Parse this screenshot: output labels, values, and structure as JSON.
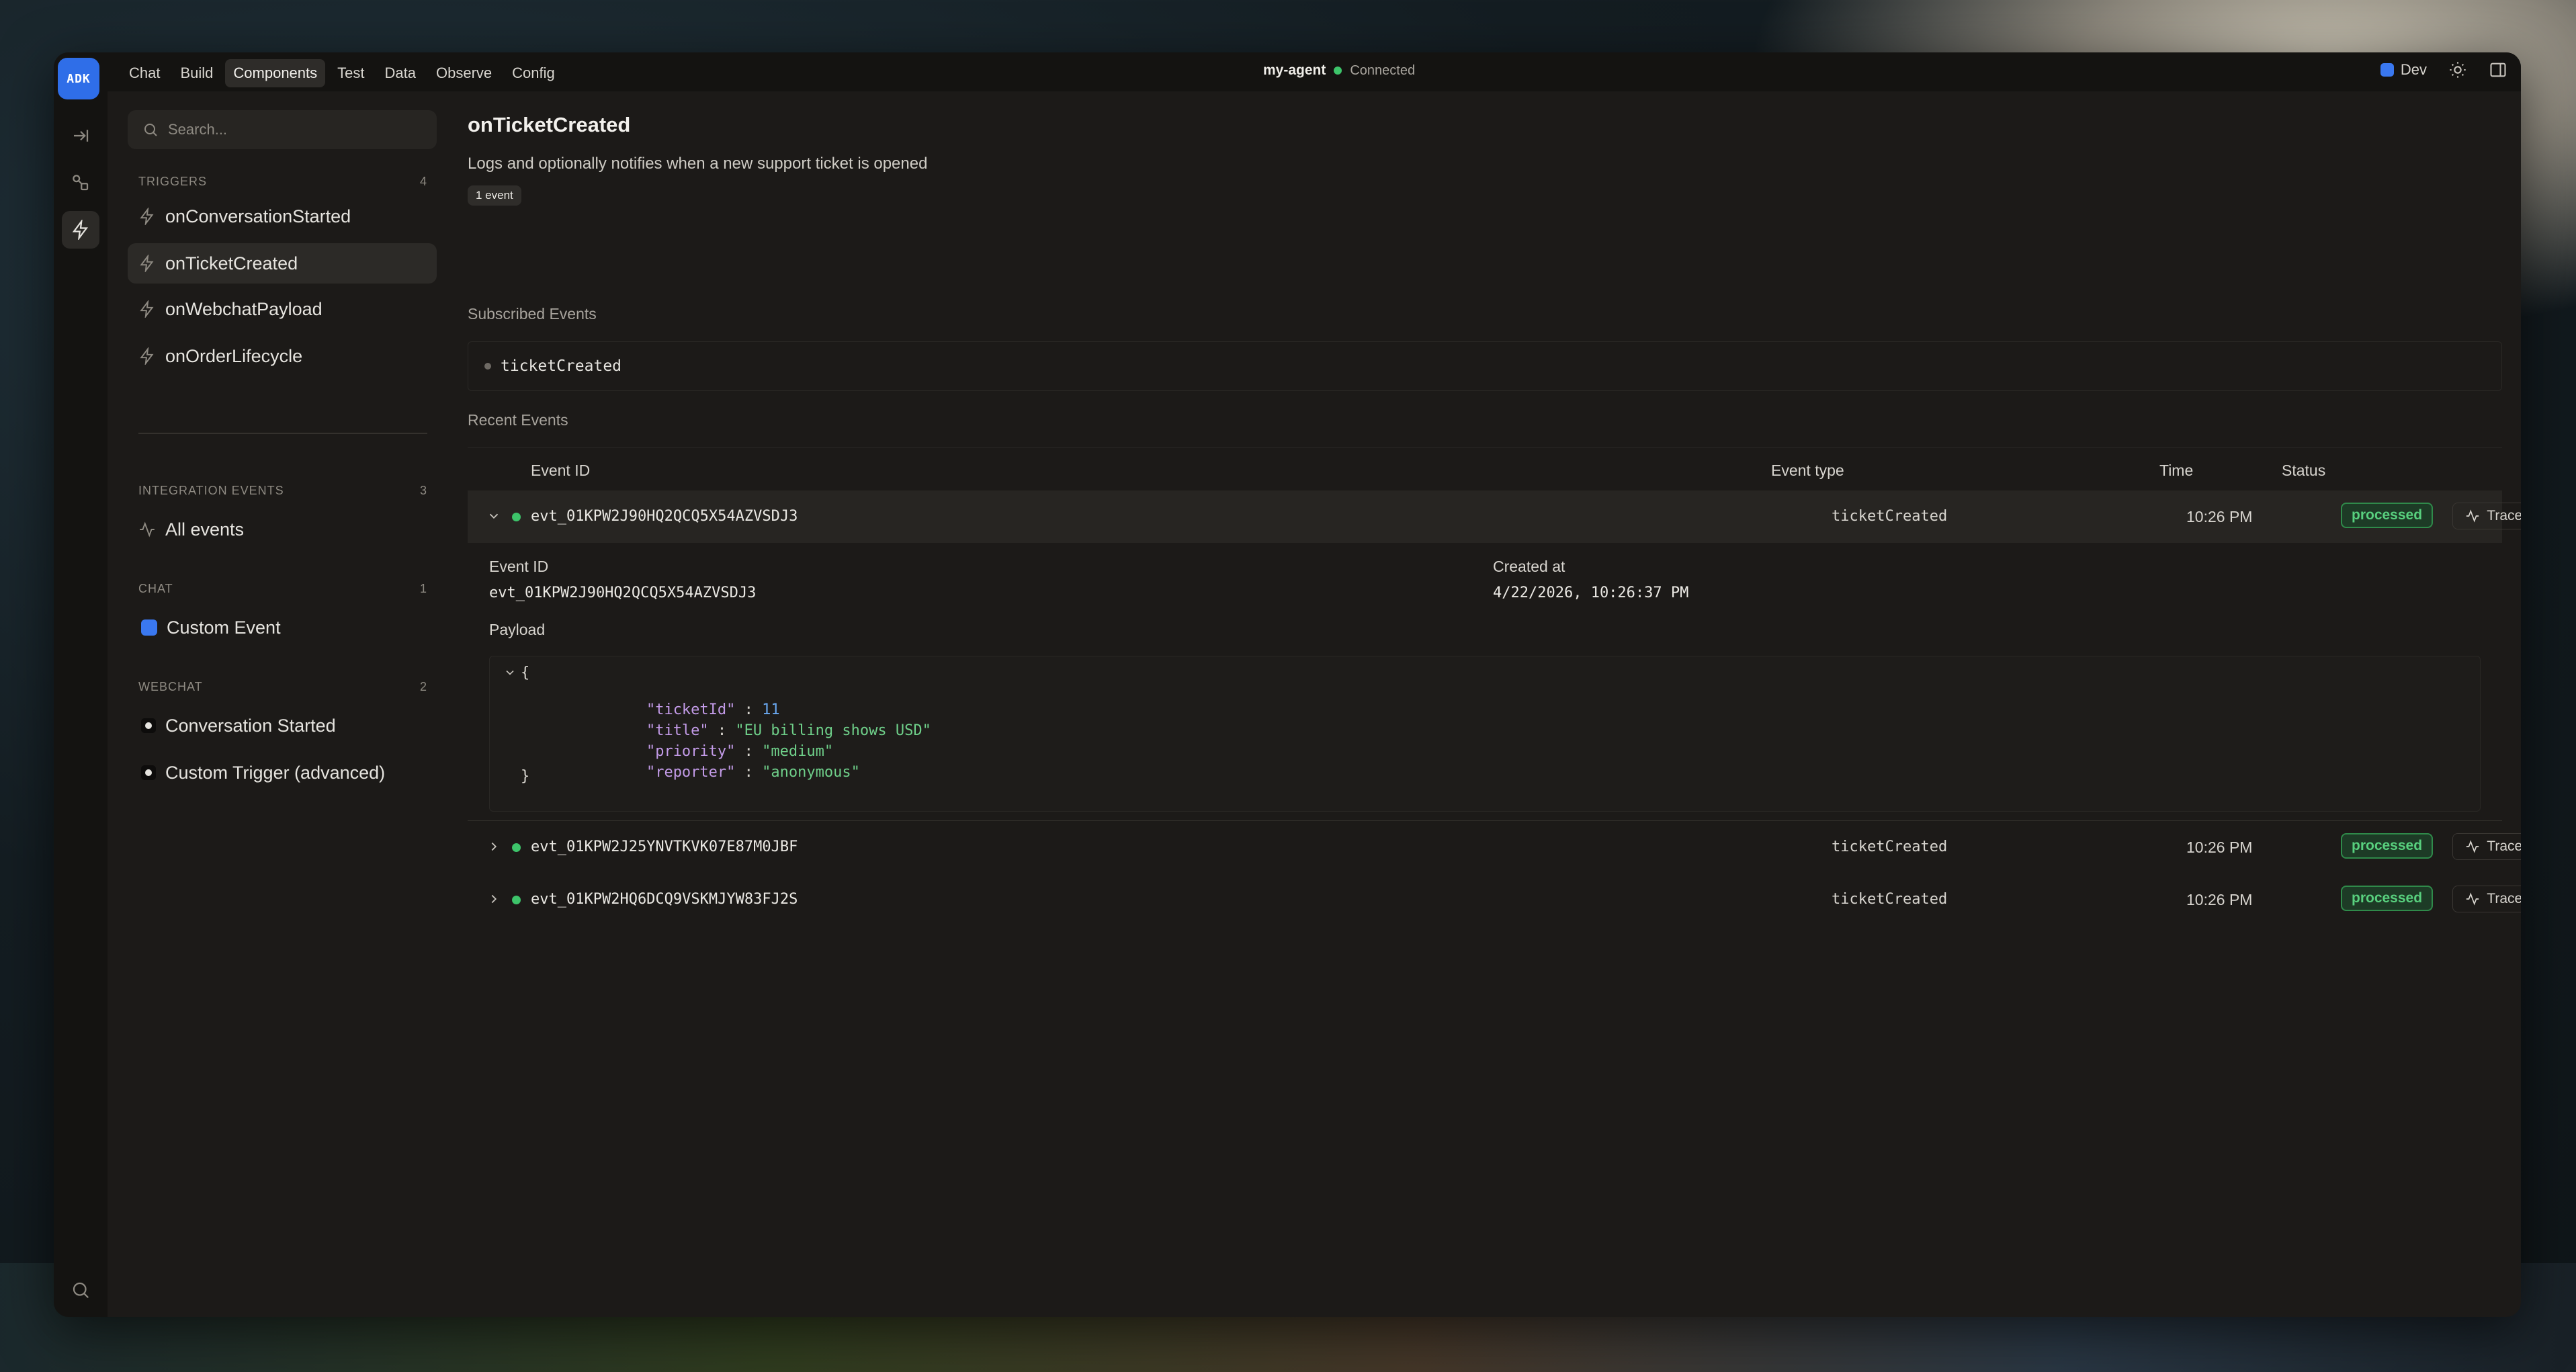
{
  "rail": {
    "logo": "ADK",
    "items": [
      {
        "icon": "arrow-right-to-line-icon",
        "active": false
      },
      {
        "icon": "shapes-icon",
        "active": false
      },
      {
        "icon": "lightning-icon",
        "active": true
      },
      {
        "icon": "search-icon",
        "active": false
      }
    ]
  },
  "nav": {
    "items": [
      "Chat",
      "Build",
      "Components",
      "Test",
      "Data",
      "Observe",
      "Config"
    ],
    "active": "Components"
  },
  "agent": {
    "name": "my-agent",
    "status": "Connected"
  },
  "topright": {
    "env": "Dev",
    "theme_icon": "sun-icon",
    "panel_icon": "sidebar-icon"
  },
  "sidebar": {
    "search_placeholder": "Search...",
    "triggers": {
      "label": "TRIGGERS",
      "count": "4",
      "items": [
        "onConversationStarted",
        "onTicketCreated",
        "onWebchatPayload",
        "onOrderLifecycle"
      ]
    },
    "integration": {
      "label": "INTEGRATION EVENTS",
      "count": "3",
      "items": [
        "All events"
      ]
    },
    "chat": {
      "label": "CHAT",
      "count": "1",
      "items": [
        "Custom Event"
      ]
    },
    "webchat": {
      "label": "WEBCHAT",
      "count": "2",
      "items": [
        "Conversation Started",
        "Custom Trigger (advanced)"
      ]
    }
  },
  "main": {
    "title": "onTicketCreated",
    "description": "Logs and optionally notifies when a new support ticket is opened",
    "badge": "1 event",
    "subscribed_label": "Subscribed Events",
    "subscribed": [
      "ticketCreated"
    ],
    "recent_label": "Recent Events",
    "columns": {
      "id": "Event ID",
      "type": "Event type",
      "time": "Time",
      "status": "Status"
    },
    "events": [
      {
        "id": "evt_01KPW2J90HQ2QCQ5X54AZVSDJ3",
        "type": "ticketCreated",
        "time": "10:26 PM",
        "status": "processed",
        "action": "Traces"
      },
      {
        "id": "evt_01KPW2J25YNVTKVK07E87M0JBF",
        "type": "ticketCreated",
        "time": "10:26 PM",
        "status": "processed",
        "action": "Traces"
      },
      {
        "id": "evt_01KPW2HQ6DCQ9VSKMJYW83FJ2S",
        "type": "ticketCreated",
        "time": "10:26 PM",
        "status": "processed",
        "action": "Traces"
      }
    ],
    "detail": {
      "id_label": "Event ID",
      "id_value": "evt_01KPW2J90HQ2QCQ5X54AZVSDJ3",
      "created_label": "Created at",
      "created_value": "4/22/2026, 10:26:37 PM",
      "payload_label": "Payload",
      "payload": {
        "ticketId_key": "\"ticketId\"",
        "ticketId_val": "11",
        "title_key": "\"title\"",
        "title_val": "\"EU billing shows USD\"",
        "priority_key": "\"priority\"",
        "priority_val": "\"medium\"",
        "reporter_key": "\"reporter\"",
        "reporter_val": "\"anonymous\""
      }
    }
  }
}
